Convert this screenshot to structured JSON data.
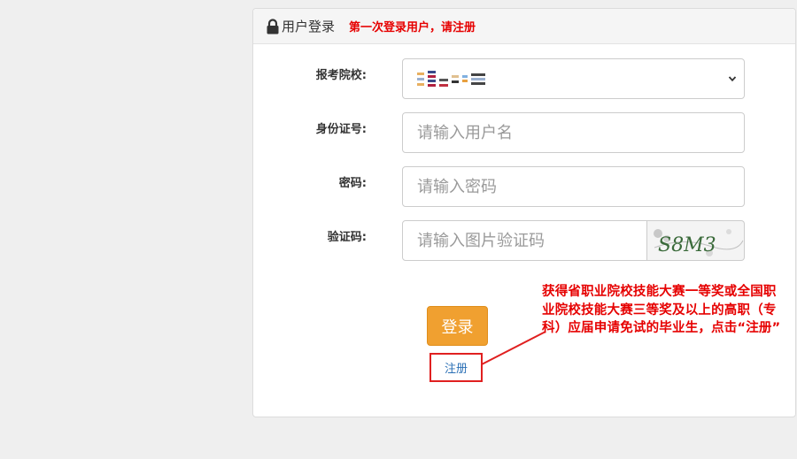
{
  "header": {
    "title": "用户登录",
    "hint": "第一次登录用户，请注册"
  },
  "form": {
    "school_label": "报考院校:",
    "id_label": "身份证号:",
    "id_placeholder": "请输入用户名",
    "password_label": "密码:",
    "password_placeholder": "请输入密码",
    "captcha_label": "验证码:",
    "captcha_placeholder": "请输入图片验证码",
    "captcha_text": "S8M3"
  },
  "actions": {
    "login_label": "登录",
    "register_label": "注册"
  },
  "annotation": {
    "text": "获得省职业院校技能大赛一等奖或全国职业院校技能大赛三等奖及以上的高职（专科）应届申请免试的毕业生，点击“注册”"
  },
  "colors": {
    "accent_orange": "#f0a030",
    "annotation_red": "#e60000",
    "link_blue": "#2a6fb5"
  }
}
